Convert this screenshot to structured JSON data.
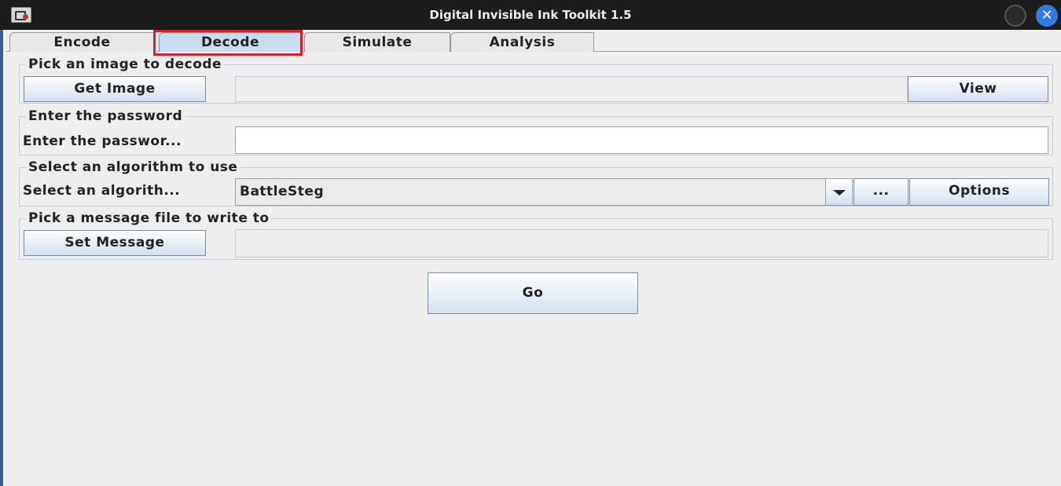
{
  "window": {
    "title": "Digital Invisible Ink Toolkit 1.5"
  },
  "tabs": [
    {
      "label": "Encode"
    },
    {
      "label": "Decode"
    },
    {
      "label": "Simulate"
    },
    {
      "label": "Analysis"
    }
  ],
  "active_tab": "Decode",
  "image_group": {
    "title": "Pick an image to decode",
    "get_button": "Get Image",
    "path_value": "",
    "view_button": "View"
  },
  "password_group": {
    "title": "Enter the password",
    "label": "Enter the passwor...",
    "value": ""
  },
  "algorithm_group": {
    "title": "Select an algorithm to use",
    "label": "Select an algorith...",
    "selected": "BattleSteg",
    "more_button": "...",
    "options_button": "Options"
  },
  "message_group": {
    "title": "Pick a message file to write to",
    "set_button": "Set Message",
    "path_value": ""
  },
  "go_button": "Go",
  "colors": {
    "titlebar": "#1c1c1c",
    "panel": "#eeeeee",
    "active_tab": "#c9dbef",
    "highlight": "#d4212b",
    "close_button": "#2f7be6"
  }
}
